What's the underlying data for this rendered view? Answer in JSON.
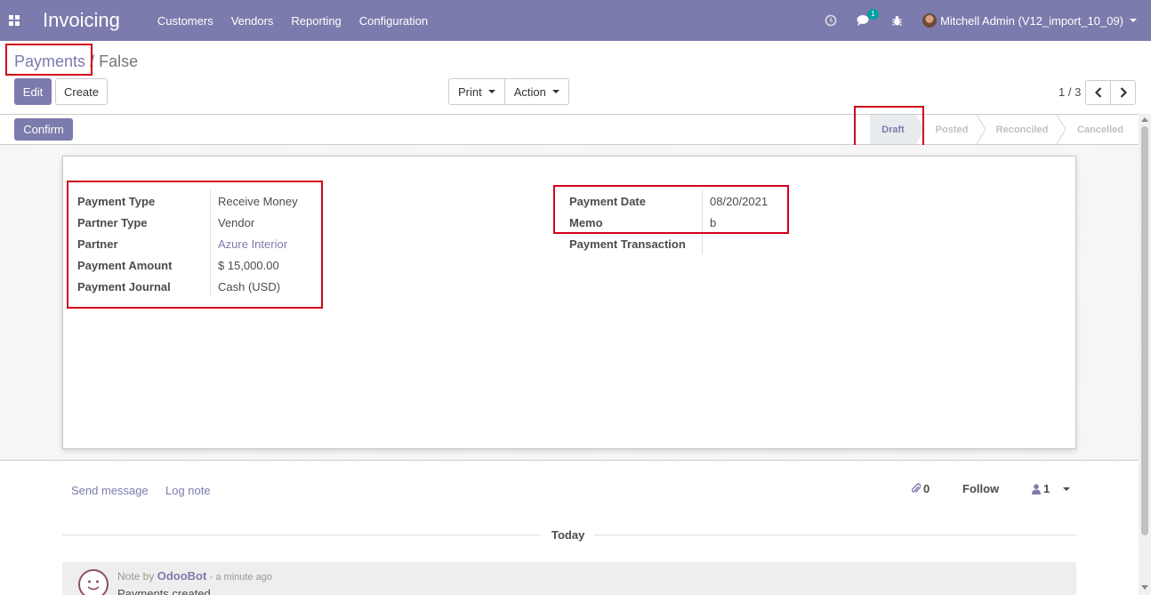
{
  "navbar": {
    "app_title": "Invoicing",
    "menu": [
      "Customers",
      "Vendors",
      "Reporting",
      "Configuration"
    ],
    "messages_badge": "1",
    "user": "Mitchell Admin (V12_import_10_09)"
  },
  "breadcrumb": {
    "parent": "Payments",
    "separator": "/",
    "current": "False"
  },
  "toolbar": {
    "edit_label": "Edit",
    "create_label": "Create",
    "print_label": "Print",
    "action_label": "Action",
    "pager": "1 / 3"
  },
  "statusbar": {
    "confirm_label": "Confirm",
    "stages": [
      "Draft",
      "Posted",
      "Reconciled",
      "Cancelled"
    ],
    "active_stage": "Draft"
  },
  "form": {
    "left": [
      {
        "label": "Payment Type",
        "value": "Receive Money"
      },
      {
        "label": "Partner Type",
        "value": "Vendor"
      },
      {
        "label": "Partner",
        "value": "Azure Interior"
      },
      {
        "label": "Payment Amount",
        "value": "$ 15,000.00"
      },
      {
        "label": "Payment Journal",
        "value": "Cash (USD)"
      }
    ],
    "right": [
      {
        "label": "Payment Date",
        "value": "08/20/2021"
      },
      {
        "label": "Memo",
        "value": "b"
      },
      {
        "label": "Payment Transaction",
        "value": ""
      }
    ]
  },
  "chatter": {
    "send_message": "Send message",
    "log_note": "Log note",
    "attachments_count": "0",
    "follow_label": "Follow",
    "followers_count": "1",
    "date_separator": "Today",
    "message": {
      "note_by": "Note by",
      "author": "OdooBot",
      "time": "- a minute ago",
      "body": "Payments created"
    }
  },
  "colors": {
    "brand": "#7c7bad",
    "highlight": "#d0021b"
  }
}
